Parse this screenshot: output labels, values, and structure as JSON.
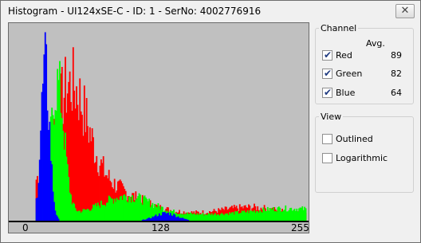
{
  "window": {
    "title": "Histogram - UI124xSE-C - ID: 1 - SerNo: 4002776916",
    "close_glyph": "✕"
  },
  "axis": {
    "ticks": [
      "0",
      "128",
      "255"
    ]
  },
  "channel_group": {
    "title": "Channel",
    "avg_header": "Avg.",
    "channels": [
      {
        "label": "Red",
        "checked": true,
        "avg": "89",
        "color": "#ff0000"
      },
      {
        "label": "Green",
        "checked": true,
        "avg": "82",
        "color": "#00ff00"
      },
      {
        "label": "Blue",
        "checked": true,
        "avg": "64",
        "color": "#0000ff"
      }
    ]
  },
  "view_group": {
    "title": "View",
    "options": [
      {
        "label": "Outlined",
        "checked": false
      },
      {
        "label": "Logarithmic",
        "checked": false
      }
    ]
  },
  "colors": {
    "plot_background": "#c0c0c0",
    "axis": "#000000"
  }
}
